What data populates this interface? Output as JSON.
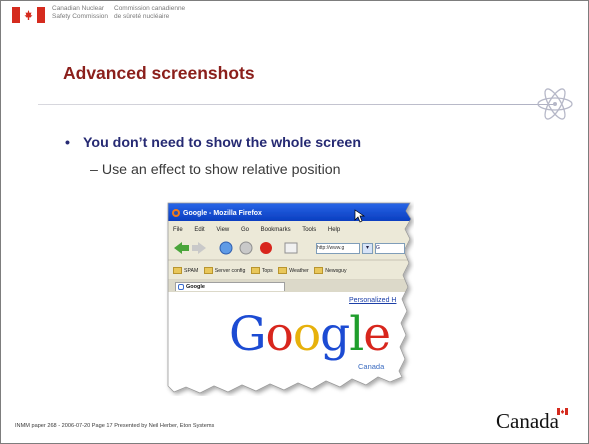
{
  "header": {
    "org_en_line1": "Canadian Nuclear",
    "org_en_line2": "Safety Commission",
    "org_fr_line1": "Commission canadienne",
    "org_fr_line2": "de sûreté nucléaire"
  },
  "slide": {
    "title": "Advanced screenshots",
    "bullet_glyph": "•",
    "bullet": "You don’t need to show the whole screen",
    "sub_bullet": "– Use an effect to show relative position"
  },
  "screenshot": {
    "window_title": "Google - Mozilla Firefox",
    "menu": [
      "File",
      "Edit",
      "View",
      "Go",
      "Bookmarks",
      "Tools",
      "Help"
    ],
    "url": "http://www.g",
    "search_prefix": "G",
    "bookmarks": [
      "SPAM",
      "Server config",
      "Tops",
      "Weather",
      "Newsguy"
    ],
    "tab_title": "Google",
    "personalized_link": "Personalized H",
    "logo_text": [
      "G",
      "o",
      "o",
      "g",
      "l",
      "e"
    ],
    "logo_sub": "Canada"
  },
  "footer": {
    "text": "INMM paper 268 - 2006-07-20  Page 17  Presented by Neil Herber, Eton Systems",
    "wordmark": "Canada"
  },
  "colors": {
    "title": "#8b1f1b",
    "bullet": "#262a73",
    "flag_red": "#d52b1e"
  }
}
